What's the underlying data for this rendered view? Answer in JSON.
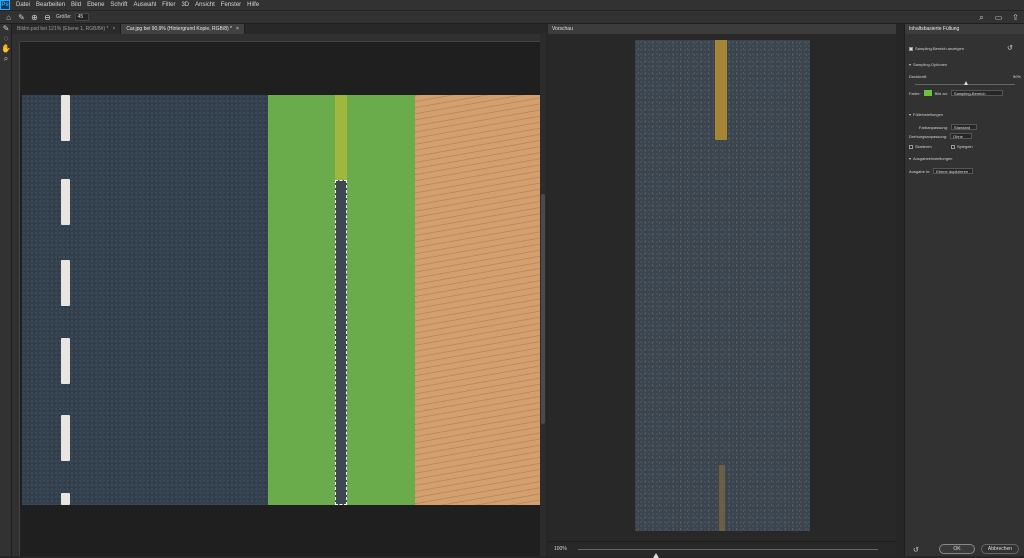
{
  "menubar": {
    "logo": "Ps",
    "items": [
      "Datei",
      "Bearbeiten",
      "Bild",
      "Ebene",
      "Schrift",
      "Auswahl",
      "Filter",
      "3D",
      "Ansicht",
      "Fenster",
      "Hilfe"
    ]
  },
  "options": {
    "size_label": "Größe:",
    "size_value": "45"
  },
  "tabs": [
    {
      "label": "Bildm.psd bei 121% (Ebene 1, RGB/8#) *",
      "active": false
    },
    {
      "label": "Car.jpg bei 90,9% (Hintergrund Kopie, RGB/8) *",
      "active": true
    }
  ],
  "preview": {
    "title": "Vorschau",
    "zoom": "100%",
    "zoom_slider_fraction": 0.26
  },
  "panel": {
    "title": "Inhaltsbasierte Füllung",
    "show_sampling": "Sampling-Bereich anzeigen",
    "section_sampling": "Sampling-Optionen",
    "opacity_label": "Deckkraft:",
    "opacity_value": "50%",
    "color_label": "Farbe:",
    "indicates_label": "Bild an:",
    "indicates_value": "Sampling-Bereich",
    "section_fill": "Fülleinstellungen",
    "color_adapt_label": "Farbanpassung:",
    "color_adapt_value": "Standard",
    "rotation_label": "Drehungsanpassung:",
    "rotation_value": "Ohne",
    "scale_label": "Skalieren",
    "mirror_label": "Spiegeln",
    "section_output": "Ausgabeeinstellungen",
    "output_label": "Ausgabe in:",
    "output_value": "Ebene duplizieren",
    "ok": "OK",
    "cancel": "Abbrechen",
    "swatch_color": "#6bc23c"
  }
}
